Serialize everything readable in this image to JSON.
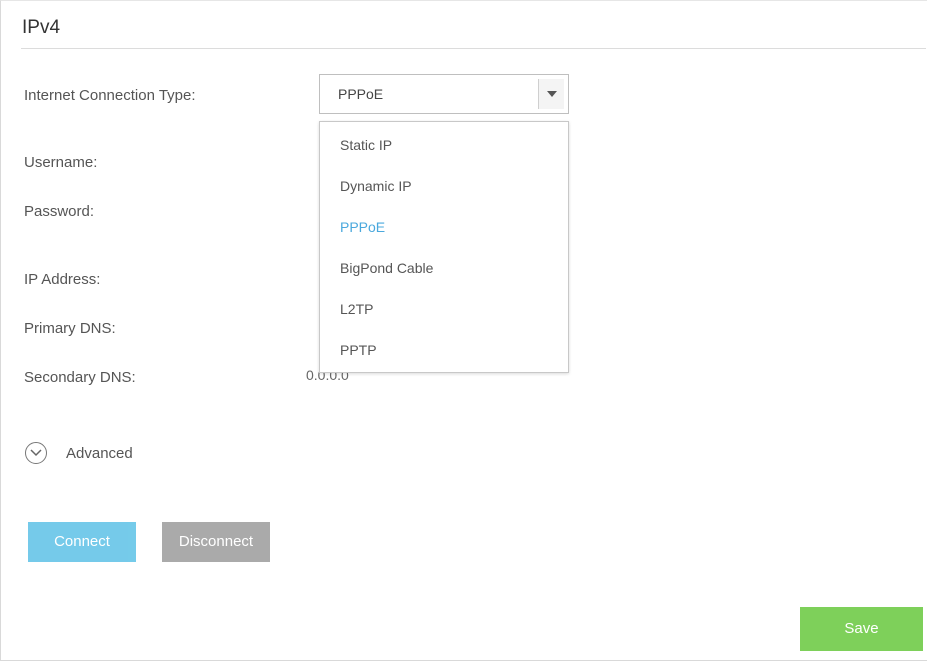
{
  "section": {
    "title": "IPv4"
  },
  "form": {
    "connection_type_label": "Internet Connection Type:",
    "connection_type_value": "PPPoE",
    "username_label": "Username:",
    "password_label": "Password:",
    "ip_address_label": "IP Address:",
    "primary_dns_label": "Primary DNS:",
    "secondary_dns_label": "Secondary DNS:",
    "secondary_dns_value": "0.0.0.0"
  },
  "dropdown": {
    "options": [
      {
        "label": "Static IP"
      },
      {
        "label": "Dynamic IP"
      },
      {
        "label": "PPPoE",
        "selected": true
      },
      {
        "label": "BigPond Cable"
      },
      {
        "label": "L2TP"
      },
      {
        "label": "PPTP"
      }
    ]
  },
  "advanced": {
    "label": "Advanced"
  },
  "buttons": {
    "connect": "Connect",
    "disconnect": "Disconnect",
    "save": "Save"
  },
  "colors": {
    "accent_blue": "#47b9e3",
    "selected_option": "#4aa8dd",
    "save_green": "#7ed05a",
    "disconnect_gray": "#9c9c9c"
  },
  "icons": {
    "dropdown_arrow": "triangle-down-icon",
    "advanced_toggle": "chevron-down-circle-icon"
  }
}
